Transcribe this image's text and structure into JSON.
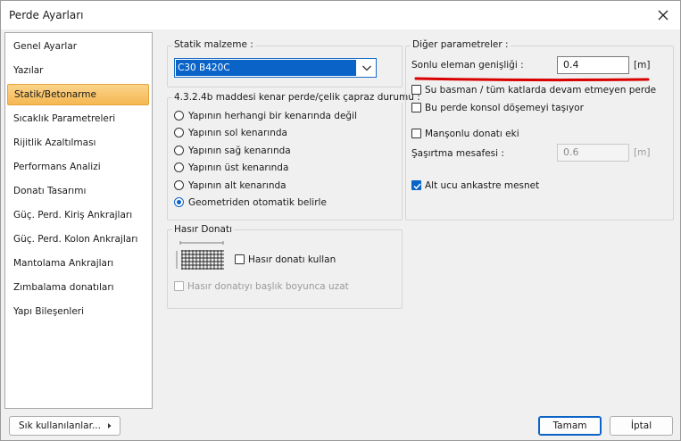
{
  "window": {
    "title": "Perde Ayarları"
  },
  "sidebar": {
    "items": [
      {
        "label": "Genel Ayarlar"
      },
      {
        "label": "Yazılar"
      },
      {
        "label": "Statik/Betonarme"
      },
      {
        "label": "Sıcaklık Parametreleri"
      },
      {
        "label": "Rijitlik Azaltılması"
      },
      {
        "label": "Performans Analizi"
      },
      {
        "label": "Donatı Tasarımı"
      },
      {
        "label": "Güç. Perd. Kiriş Ankrajları"
      },
      {
        "label": "Güç. Perd. Kolon Ankrajları"
      },
      {
        "label": "Mantolama Ankrajları"
      },
      {
        "label": "Zımbalama donatıları"
      },
      {
        "label": "Yapı Bileşenleri"
      }
    ],
    "selected": "Statik/Betonarme"
  },
  "material": {
    "group_label": "Statik malzeme :",
    "selected": "C30 B420C"
  },
  "cross_brace": {
    "group_label": "4.3.2.4b maddesi kenar perde/çelik çapraz durumu :",
    "options": [
      "Yapının herhangi bir kenarında değil",
      "Yapının sol kenarında",
      "Yapının sağ kenarında",
      "Yapının üst kenarında",
      "Yapının alt kenarında",
      "Geometriden otomatik belirle"
    ],
    "selected": "Geometriden otomatik belirle"
  },
  "mesh": {
    "group_label": "Hasır Donatı",
    "use_label": "Hasır donatı kullan",
    "use_checked": false,
    "extend_label": "Hasır donatıyı başlık boyunca uzat",
    "extend_checked": false
  },
  "other": {
    "group_label": "Diğer parametreler :",
    "fe_width_label": "Sonlu eleman genişliği :",
    "fe_width_value": "0.4",
    "fe_width_unit": "[m]",
    "basement_label": "Su basman / tüm katlarda devam etmeyen perde",
    "basement_checked": false,
    "console_label": "Bu perde konsol döşemeyi taşıyor",
    "console_checked": false,
    "sleeve_label": "Manşonlu donatı eki",
    "sleeve_checked": false,
    "stagger_label": "Şaşırtma mesafesi :",
    "stagger_value": "0.6",
    "stagger_unit": "[m]",
    "bottom_support_label": "Alt ucu ankastre mesnet",
    "bottom_support_checked": true,
    "highlight_color": "#d90000"
  },
  "footer": {
    "favorites_label": "Sık kullanılanlar...",
    "ok_label": "Tamam",
    "cancel_label": "İptal"
  },
  "colors": {
    "accent": "#0a64c8",
    "selected_item": "#f5b752"
  }
}
